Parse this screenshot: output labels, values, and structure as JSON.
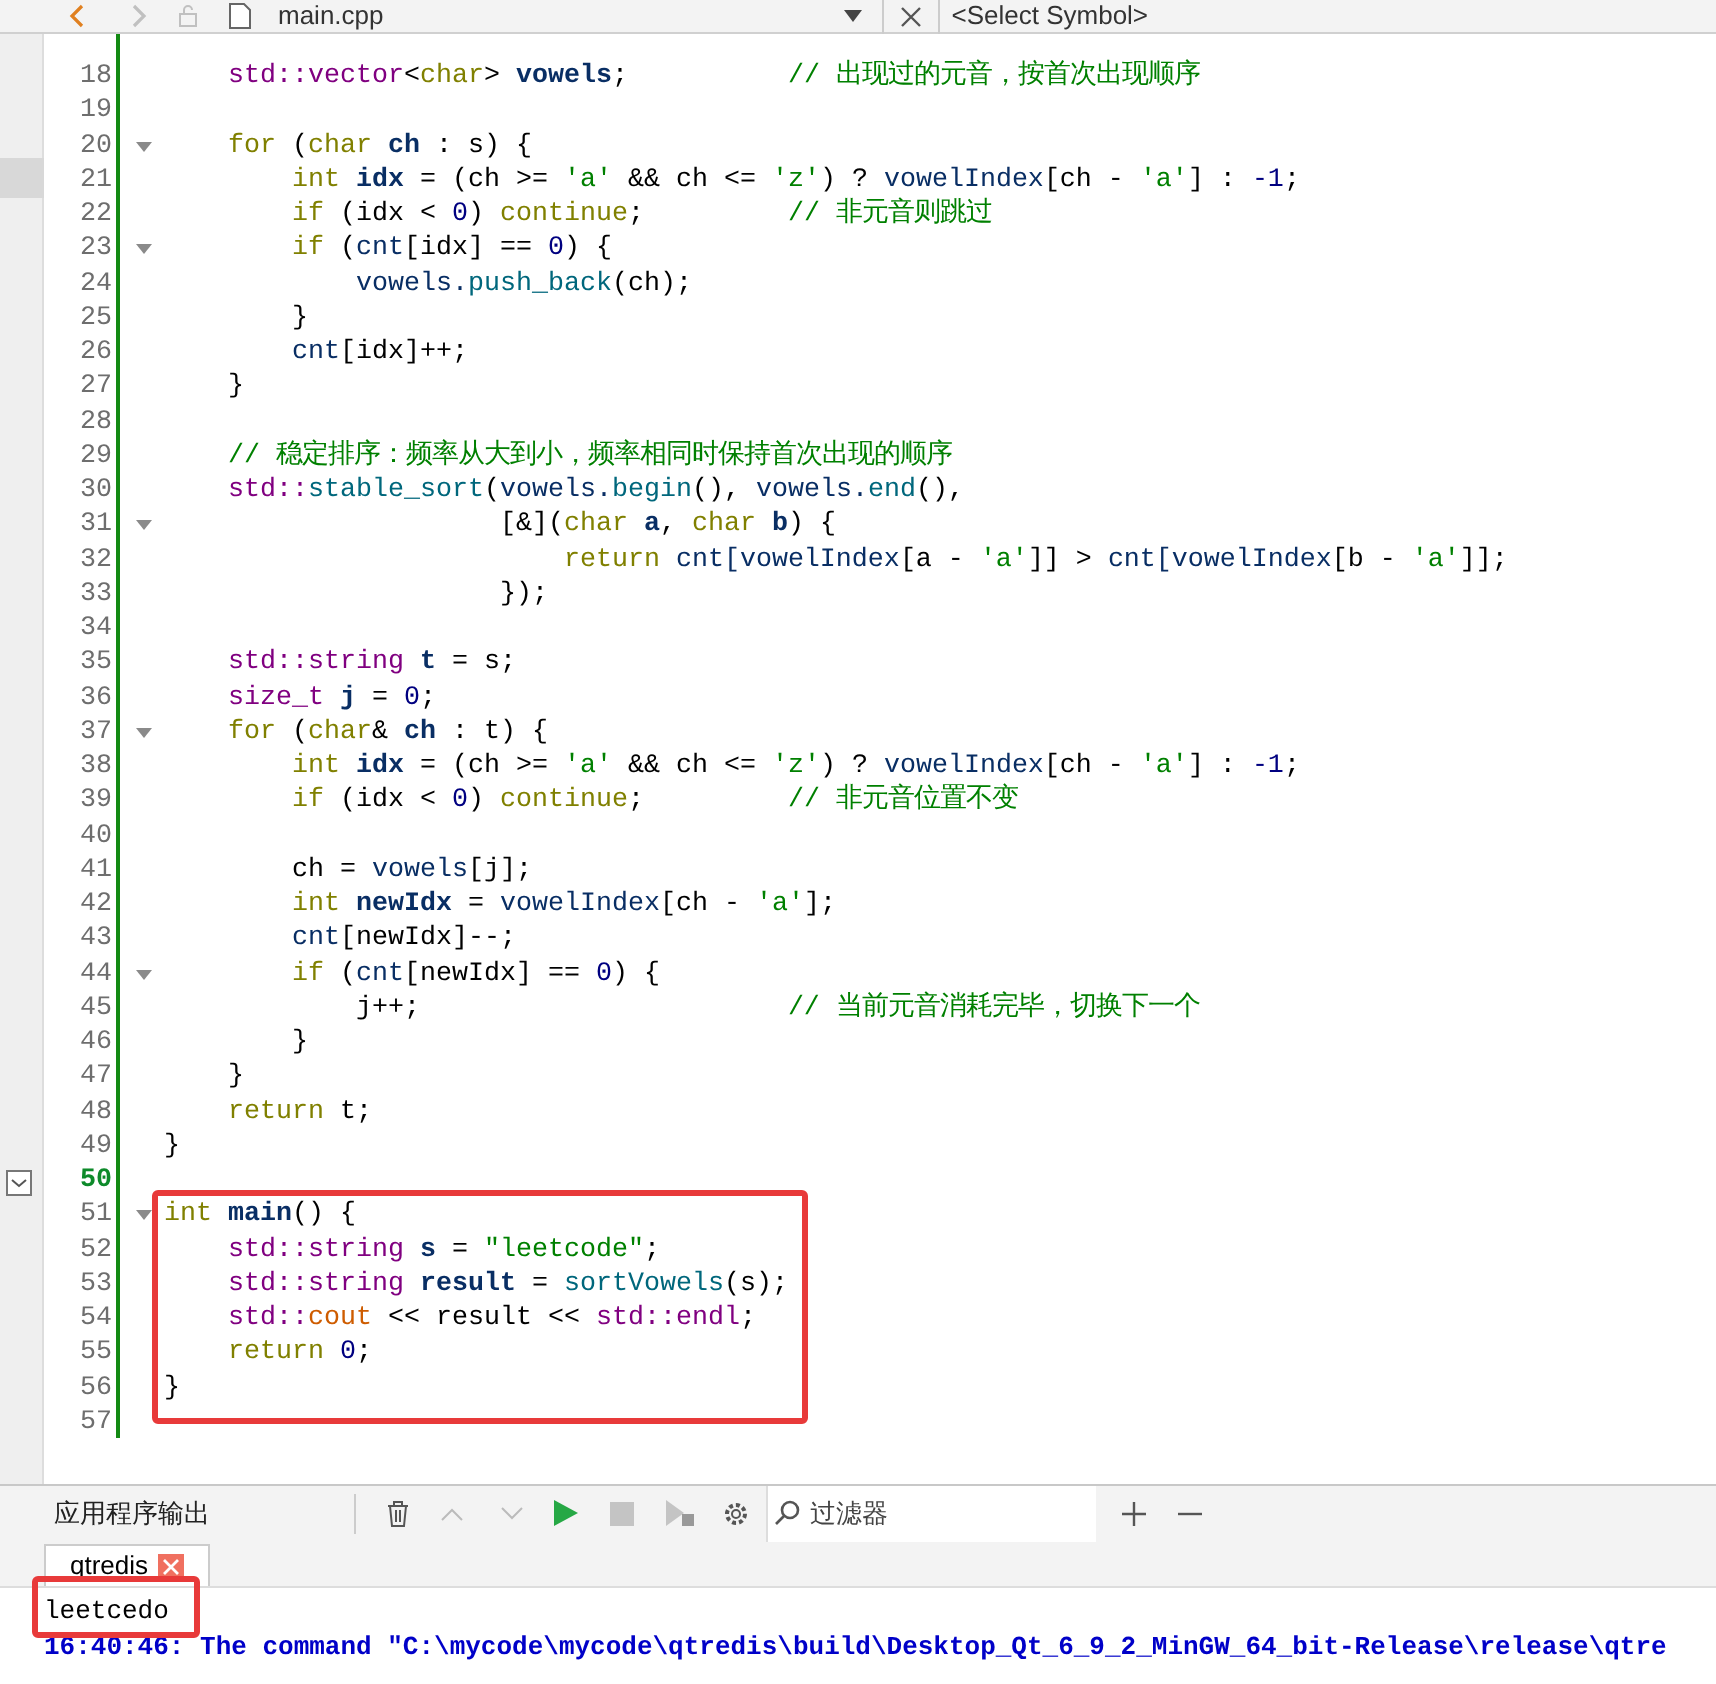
{
  "editor_toolbar": {
    "file": "main.cpp",
    "symbol": "<Select Symbol>"
  },
  "editor": {
    "lines": [
      {
        "number": "18",
        "fold": false,
        "current": false,
        "tokens": [
          {
            "kind": "type",
            "text": "    std::vector"
          },
          {
            "kind": "plain",
            "text": "<"
          },
          {
            "kind": "keyword",
            "text": "char"
          },
          {
            "kind": "plain",
            "text": "> "
          },
          {
            "kind": "decl",
            "text": "vowels"
          },
          {
            "kind": "plain",
            "text": ";          "
          },
          {
            "kind": "comment",
            "text": "// 出现过的元音，按首次出现顺序"
          }
        ]
      },
      {
        "number": "19",
        "fold": false,
        "current": false
      },
      {
        "number": "20",
        "fold": true,
        "current": false,
        "tokens": [
          {
            "kind": "keyword",
            "text": "    for"
          },
          {
            "kind": "plain",
            "text": " ("
          },
          {
            "kind": "keyword",
            "text": "char"
          },
          {
            "kind": "decl",
            "text": " ch"
          },
          {
            "kind": "plain",
            "text": " : s) {"
          }
        ]
      },
      {
        "number": "21",
        "fold": false,
        "current": false,
        "tokens": [
          {
            "kind": "keyword",
            "text": "        int"
          },
          {
            "kind": "decl",
            "text": " idx"
          },
          {
            "kind": "plain",
            "text": " = (ch >= "
          },
          {
            "kind": "string",
            "text": "'a'"
          },
          {
            "kind": "plain",
            "text": " && ch <= "
          },
          {
            "kind": "string",
            "text": "'z'"
          },
          {
            "kind": "plain",
            "text": ") ? "
          },
          {
            "kind": "var",
            "text": "vowelIndex"
          },
          {
            "kind": "plain",
            "text": "[ch - "
          },
          {
            "kind": "string",
            "text": "'a'"
          },
          {
            "kind": "plain",
            "text": "] : "
          },
          {
            "kind": "number",
            "text": "-1"
          },
          {
            "kind": "plain",
            "text": ";"
          }
        ]
      },
      {
        "number": "22",
        "fold": false,
        "current": false,
        "tokens": [
          {
            "kind": "keyword",
            "text": "        if"
          },
          {
            "kind": "plain",
            "text": " (idx < "
          },
          {
            "kind": "number",
            "text": "0"
          },
          {
            "kind": "plain",
            "text": ") "
          },
          {
            "kind": "keyword",
            "text": "continue"
          },
          {
            "kind": "plain",
            "text": ";         "
          },
          {
            "kind": "comment",
            "text": "// 非元音则跳过"
          }
        ]
      },
      {
        "number": "23",
        "fold": true,
        "current": false,
        "tokens": [
          {
            "kind": "keyword",
            "text": "        if"
          },
          {
            "kind": "plain",
            "text": " ("
          },
          {
            "kind": "var",
            "text": "cnt"
          },
          {
            "kind": "plain",
            "text": "[idx] == "
          },
          {
            "kind": "number",
            "text": "0"
          },
          {
            "kind": "plain",
            "text": ") {"
          }
        ]
      },
      {
        "number": "24",
        "fold": false,
        "current": false,
        "tokens": [
          {
            "kind": "var",
            "text": "            vowels."
          },
          {
            "kind": "func",
            "text": "push_back"
          },
          {
            "kind": "plain",
            "text": "(ch);"
          }
        ]
      },
      {
        "number": "25",
        "fold": false,
        "current": false,
        "tokens": [
          {
            "kind": "plain",
            "text": "        }"
          }
        ]
      },
      {
        "number": "26",
        "fold": false,
        "current": false,
        "tokens": [
          {
            "kind": "var",
            "text": "        cnt"
          },
          {
            "kind": "plain",
            "text": "[idx]++;"
          }
        ]
      },
      {
        "number": "27",
        "fold": false,
        "current": false,
        "tokens": [
          {
            "kind": "plain",
            "text": "    }"
          }
        ]
      },
      {
        "number": "28",
        "fold": false,
        "current": false
      },
      {
        "number": "29",
        "fold": false,
        "current": false,
        "tokens": [
          {
            "kind": "comment",
            "text": "    // 稳定排序：频率从大到小，频率相同时保持首次出现的顺序"
          }
        ]
      },
      {
        "number": "30",
        "fold": false,
        "current": false,
        "tokens": [
          {
            "kind": "type",
            "text": "    std::"
          },
          {
            "kind": "func",
            "text": "stable_sort"
          },
          {
            "kind": "plain",
            "text": "("
          },
          {
            "kind": "var",
            "text": "vowels."
          },
          {
            "kind": "func",
            "text": "begin"
          },
          {
            "kind": "plain",
            "text": "(), "
          },
          {
            "kind": "var",
            "text": "vowels."
          },
          {
            "kind": "func",
            "text": "end"
          },
          {
            "kind": "plain",
            "text": "(),"
          }
        ]
      },
      {
        "number": "31",
        "fold": true,
        "current": false,
        "tokens": [
          {
            "kind": "plain",
            "text": "                     [&]("
          },
          {
            "kind": "keyword",
            "text": "char"
          },
          {
            "kind": "decl",
            "text": " a"
          },
          {
            "kind": "plain",
            "text": ", "
          },
          {
            "kind": "keyword",
            "text": "char"
          },
          {
            "kind": "decl",
            "text": " b"
          },
          {
            "kind": "plain",
            "text": ") {"
          }
        ]
      },
      {
        "number": "32",
        "fold": false,
        "current": false,
        "tokens": [
          {
            "kind": "keyword",
            "text": "                         return"
          },
          {
            "kind": "var",
            "text": " cnt[vowelIndex"
          },
          {
            "kind": "plain",
            "text": "[a - "
          },
          {
            "kind": "string",
            "text": "'a'"
          },
          {
            "kind": "plain",
            "text": "]] > "
          },
          {
            "kind": "var",
            "text": "cnt[vowelIndex"
          },
          {
            "kind": "plain",
            "text": "[b - "
          },
          {
            "kind": "string",
            "text": "'a'"
          },
          {
            "kind": "plain",
            "text": "]];"
          }
        ]
      },
      {
        "number": "33",
        "fold": false,
        "current": false,
        "tokens": [
          {
            "kind": "plain",
            "text": "                     });"
          }
        ]
      },
      {
        "number": "34",
        "fold": false,
        "current": false
      },
      {
        "number": "35",
        "fold": false,
        "current": false,
        "tokens": [
          {
            "kind": "type",
            "text": "    std::string"
          },
          {
            "kind": "decl",
            "text": " t"
          },
          {
            "kind": "plain",
            "text": " = s;"
          }
        ]
      },
      {
        "number": "36",
        "fold": false,
        "current": false,
        "tokens": [
          {
            "kind": "type",
            "text": "    size_t"
          },
          {
            "kind": "decl",
            "text": " j"
          },
          {
            "kind": "plain",
            "text": " = "
          },
          {
            "kind": "number",
            "text": "0"
          },
          {
            "kind": "plain",
            "text": ";"
          }
        ]
      },
      {
        "number": "37",
        "fold": true,
        "current": false,
        "tokens": [
          {
            "kind": "keyword",
            "text": "    for"
          },
          {
            "kind": "plain",
            "text": " ("
          },
          {
            "kind": "keyword",
            "text": "char"
          },
          {
            "kind": "plain",
            "text": "& "
          },
          {
            "kind": "decl",
            "text": "ch"
          },
          {
            "kind": "plain",
            "text": " : t) {"
          }
        ]
      },
      {
        "number": "38",
        "fold": false,
        "current": false,
        "tokens": [
          {
            "kind": "keyword",
            "text": "        int"
          },
          {
            "kind": "decl",
            "text": " idx"
          },
          {
            "kind": "plain",
            "text": " = (ch >= "
          },
          {
            "kind": "string",
            "text": "'a'"
          },
          {
            "kind": "plain",
            "text": " && ch <= "
          },
          {
            "kind": "string",
            "text": "'z'"
          },
          {
            "kind": "plain",
            "text": ") ? "
          },
          {
            "kind": "var",
            "text": "vowelIndex"
          },
          {
            "kind": "plain",
            "text": "[ch - "
          },
          {
            "kind": "string",
            "text": "'a'"
          },
          {
            "kind": "plain",
            "text": "] : "
          },
          {
            "kind": "number",
            "text": "-1"
          },
          {
            "kind": "plain",
            "text": ";"
          }
        ]
      },
      {
        "number": "39",
        "fold": false,
        "current": false,
        "tokens": [
          {
            "kind": "keyword",
            "text": "        if"
          },
          {
            "kind": "plain",
            "text": " (idx < "
          },
          {
            "kind": "number",
            "text": "0"
          },
          {
            "kind": "plain",
            "text": ") "
          },
          {
            "kind": "keyword",
            "text": "continue"
          },
          {
            "kind": "plain",
            "text": ";         "
          },
          {
            "kind": "comment",
            "text": "// 非元音位置不变"
          }
        ]
      },
      {
        "number": "40",
        "fold": false,
        "current": false
      },
      {
        "number": "41",
        "fold": false,
        "current": false,
        "tokens": [
          {
            "kind": "plain",
            "text": "        ch = "
          },
          {
            "kind": "var",
            "text": "vowels"
          },
          {
            "kind": "plain",
            "text": "[j];"
          }
        ]
      },
      {
        "number": "42",
        "fold": false,
        "current": false,
        "tokens": [
          {
            "kind": "keyword",
            "text": "        int"
          },
          {
            "kind": "decl",
            "text": " newIdx"
          },
          {
            "kind": "plain",
            "text": " = "
          },
          {
            "kind": "var",
            "text": "vowelIndex"
          },
          {
            "kind": "plain",
            "text": "[ch - "
          },
          {
            "kind": "string",
            "text": "'a'"
          },
          {
            "kind": "plain",
            "text": "];"
          }
        ]
      },
      {
        "number": "43",
        "fold": false,
        "current": false,
        "tokens": [
          {
            "kind": "var",
            "text": "        cnt"
          },
          {
            "kind": "plain",
            "text": "[newIdx]--;"
          }
        ]
      },
      {
        "number": "44",
        "fold": true,
        "current": false,
        "tokens": [
          {
            "kind": "keyword",
            "text": "        if"
          },
          {
            "kind": "plain",
            "text": " ("
          },
          {
            "kind": "var",
            "text": "cnt"
          },
          {
            "kind": "plain",
            "text": "[newIdx] == "
          },
          {
            "kind": "number",
            "text": "0"
          },
          {
            "kind": "plain",
            "text": ") {"
          }
        ]
      },
      {
        "number": "45",
        "fold": false,
        "current": false,
        "tokens": [
          {
            "kind": "plain",
            "text": "            j++;                       "
          },
          {
            "kind": "comment",
            "text": "// 当前元音消耗完毕，切换下一个"
          }
        ]
      },
      {
        "number": "46",
        "fold": false,
        "current": false,
        "tokens": [
          {
            "kind": "plain",
            "text": "        }"
          }
        ]
      },
      {
        "number": "47",
        "fold": false,
        "current": false,
        "tokens": [
          {
            "kind": "plain",
            "text": "    }"
          }
        ]
      },
      {
        "number": "48",
        "fold": false,
        "current": false,
        "tokens": [
          {
            "kind": "keyword",
            "text": "    return"
          },
          {
            "kind": "plain",
            "text": " t;"
          }
        ]
      },
      {
        "number": "49",
        "fold": false,
        "current": false,
        "tokens": [
          {
            "kind": "plain",
            "text": "}"
          }
        ]
      },
      {
        "number": "50",
        "fold": false,
        "current": true
      },
      {
        "number": "51",
        "fold": true,
        "current": false,
        "tokens": [
          {
            "kind": "keyword",
            "text": "int"
          },
          {
            "kind": "decl",
            "text": " main"
          },
          {
            "kind": "plain",
            "text": "() {"
          }
        ]
      },
      {
        "number": "52",
        "fold": false,
        "current": false,
        "tokens": [
          {
            "kind": "type",
            "text": "    std::string"
          },
          {
            "kind": "decl",
            "text": " s"
          },
          {
            "kind": "plain",
            "text": " = "
          },
          {
            "kind": "string",
            "text": "\"leetcode\""
          },
          {
            "kind": "plain",
            "text": ";"
          }
        ]
      },
      {
        "number": "53",
        "fold": false,
        "current": false,
        "tokens": [
          {
            "kind": "type",
            "text": "    std::string"
          },
          {
            "kind": "decl",
            "text": " result"
          },
          {
            "kind": "plain",
            "text": " = "
          },
          {
            "kind": "func",
            "text": "sortVowels"
          },
          {
            "kind": "plain",
            "text": "(s);"
          }
        ]
      },
      {
        "number": "54",
        "fold": false,
        "current": false,
        "tokens": [
          {
            "kind": "type",
            "text": "    std::"
          },
          {
            "kind": "global",
            "text": "cout"
          },
          {
            "kind": "plain",
            "text": " << result << "
          },
          {
            "kind": "type",
            "text": "std::endl"
          },
          {
            "kind": "plain",
            "text": ";"
          }
        ]
      },
      {
        "number": "55",
        "fold": false,
        "current": false,
        "tokens": [
          {
            "kind": "keyword",
            "text": "    return"
          },
          {
            "kind": "number",
            "text": " 0"
          },
          {
            "kind": "plain",
            "text": ";"
          }
        ]
      },
      {
        "number": "56",
        "fold": false,
        "current": false,
        "tokens": [
          {
            "kind": "plain",
            "text": "}"
          }
        ]
      },
      {
        "number": "57",
        "fold": false,
        "current": false
      }
    ]
  },
  "output_pane": {
    "title": "应用程序输出",
    "filter_placeholder": "过滤器",
    "tabs": [
      {
        "label": "qtredis",
        "selected": true
      }
    ],
    "lines": [
      {
        "kind": "stdout",
        "text": "leetcedo"
      },
      {
        "kind": "status",
        "text": "16:40:46: The command \"C:\\mycode\\mycode\\qtredis\\build\\Desktop_Qt_6_9_2_MinGW_64_bit-Release\\release\\qtre"
      }
    ]
  }
}
